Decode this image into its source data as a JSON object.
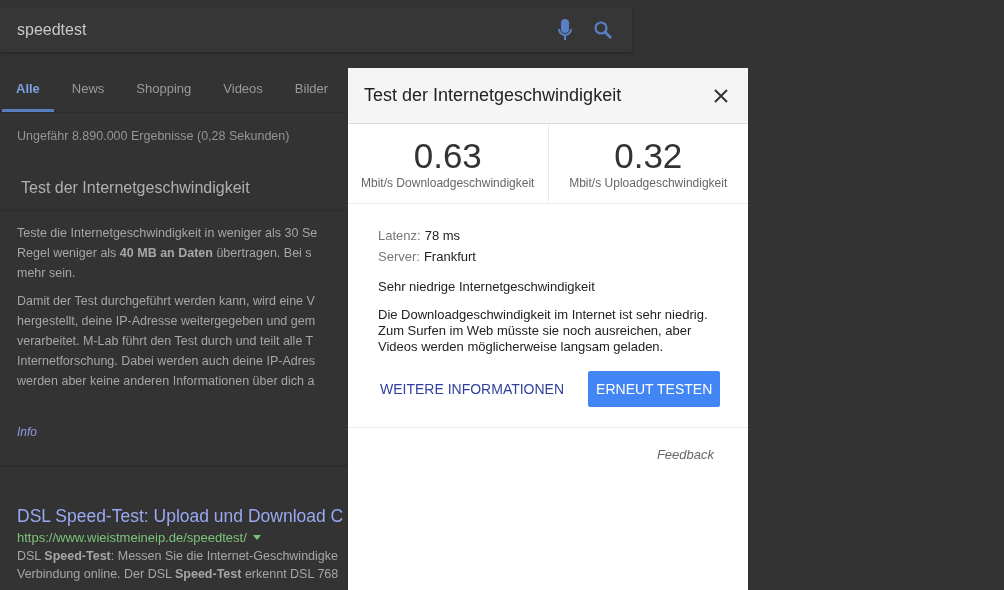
{
  "search": {
    "query": "speedtest"
  },
  "tabs": [
    {
      "label": "Alle",
      "selected": true
    },
    {
      "label": "News",
      "selected": false
    },
    {
      "label": "Shopping",
      "selected": false
    },
    {
      "label": "Videos",
      "selected": false
    },
    {
      "label": "Bilder",
      "selected": false
    }
  ],
  "result_stats": "Ungefähr 8.890.000 Ergebnisse (0,28 Sekunden)",
  "card": {
    "title": "Test der Internetgeschwindigkeit",
    "paragraphs": [
      [
        "Teste die Internetgeschwindigkeit in weniger als 30 Se",
        "Regel weniger als **40 MB an Daten** übertragen. Bei s",
        "mehr sein."
      ],
      [
        "Damit der Test durchgeführt werden kann, wird eine V",
        "hergestellt, deine IP-Adresse weitergegeben und gem",
        "verarbeitet. M-Lab führt den Test durch und teilt alle T",
        "Internetforschung. Dabei werden auch deine IP-Adres",
        "werden aber keine anderen Informationen über dich a"
      ]
    ],
    "link": "Info"
  },
  "results": [
    {
      "title": "DSL Speed-Test: Upload und Download C",
      "url": "https://www.wieistmeineip.de/speedtest/",
      "snippet": [
        "DSL **Speed-Test**: Messen Sie die Internet-Geschwindigke",
        "Verbindung online. Der DSL **Speed-Test** erkennt DSL 768"
      ]
    }
  ],
  "dialog": {
    "title": "Test der Internetgeschwindigkeit",
    "speeds": [
      {
        "value": "0.63",
        "label": "Mbit/s Downloadgeschwindigkeit"
      },
      {
        "value": "0.32",
        "label": "Mbit/s Uploadgeschwindigkeit"
      }
    ],
    "details": [
      {
        "label": "Latenz:",
        "value": "78 ms"
      },
      {
        "label": "Server:",
        "value": "Frankfurt"
      }
    ],
    "verdict": "Sehr niedrige Internetgeschwindigkeit",
    "description": "Die Downloadgeschwindigkeit im Internet ist sehr niedrig. Zum Surfen im Web müsste sie noch ausreichen, aber Videos werden möglicherweise langsam geladen.",
    "buttons": [
      {
        "label": "WEITERE INFORMATIONEN",
        "kind": "text"
      },
      {
        "label": "ERNEUT TESTEN",
        "kind": "primary"
      }
    ],
    "feedback": "Feedback"
  }
}
